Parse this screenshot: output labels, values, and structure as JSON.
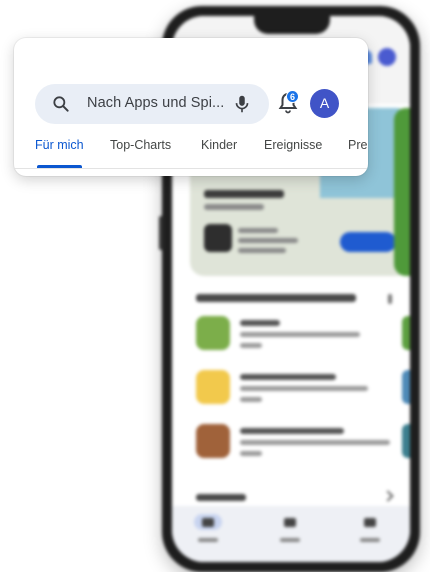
{
  "search": {
    "placeholder": "Nach Apps und Spi..."
  },
  "notifications": {
    "badge_count": "6"
  },
  "account": {
    "avatar_initial": "A",
    "avatar_color": "#4054c7"
  },
  "tabs": [
    {
      "label": "Für mich",
      "active": true
    },
    {
      "label": "Top-Charts",
      "active": false
    },
    {
      "label": "Kinder",
      "active": false
    },
    {
      "label": "Ereignisse",
      "active": false
    },
    {
      "label": "Pre",
      "active": false
    }
  ],
  "colors": {
    "accent": "#0b57d0",
    "search_bg": "#e9eef6",
    "badge": "#1a73e8"
  },
  "icons": {
    "search": "search-icon",
    "mic": "mic-icon",
    "bell": "bell-icon"
  }
}
